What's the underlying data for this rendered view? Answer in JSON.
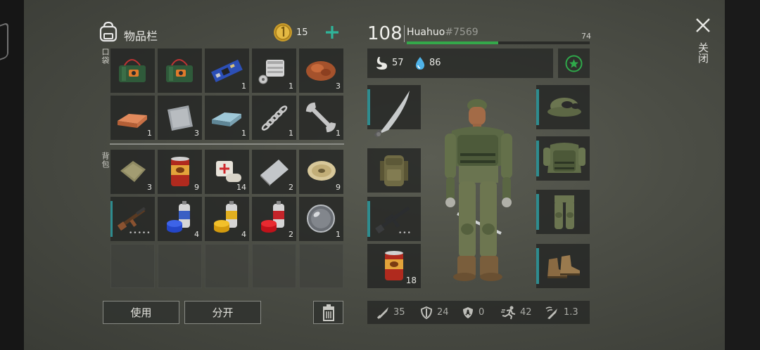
{
  "inventory": {
    "title": "物品栏",
    "coins": "15",
    "pocket_label": "口袋",
    "backpack_label": "背包",
    "pocket_items": [
      {
        "icon": "explosive-pack-icon",
        "count": ""
      },
      {
        "icon": "explosive-pack-icon",
        "count": ""
      },
      {
        "icon": "circuit-board-icon",
        "count": "1"
      },
      {
        "icon": "engine-part-icon",
        "count": "1"
      },
      {
        "icon": "meat-icon",
        "count": "3"
      },
      {
        "icon": "copper-ingot-icon",
        "count": "1"
      },
      {
        "icon": "metal-plate-icon",
        "count": "3"
      },
      {
        "icon": "steel-ingot-icon",
        "count": "1"
      },
      {
        "icon": "spring-icon",
        "count": "1"
      },
      {
        "icon": "wrench-icon",
        "count": "1"
      }
    ],
    "backpack_items": [
      {
        "icon": "cloth-icon",
        "count": "3"
      },
      {
        "icon": "canned-food-icon",
        "count": "9"
      },
      {
        "icon": "bandage-icon",
        "count": "14"
      },
      {
        "icon": "steel-sheet-icon",
        "count": "2"
      },
      {
        "icon": "wire-spool-icon",
        "count": "9"
      },
      {
        "icon": "assault-rifle-icon",
        "count": ""
      },
      {
        "icon": "blue-spray-paint-icon",
        "count": "4"
      },
      {
        "icon": "yellow-spray-paint-icon",
        "count": "4"
      },
      {
        "icon": "red-spray-paint-icon",
        "count": "2"
      },
      {
        "icon": "glass-lens-icon",
        "count": "1"
      }
    ],
    "use_button": "使用",
    "split_button": "分开"
  },
  "character": {
    "level": "108",
    "name": "Huahuo",
    "tag": "#7569",
    "xp_value": "74",
    "xp_progress": 0.5,
    "hunger": "57",
    "thirst": "86",
    "close_label": "关闭",
    "equipment": {
      "weapon_left_top": {
        "icon": "machete-icon"
      },
      "backpack": {
        "icon": "backpack-icon"
      },
      "rifle": {
        "icon": "m16-rifle-icon"
      },
      "food": {
        "icon": "canned-food-icon",
        "count": "18"
      },
      "head": {
        "icon": "camo-cap-icon"
      },
      "body": {
        "icon": "camo-vest-icon"
      },
      "legs": {
        "icon": "camo-pants-icon"
      },
      "feet": {
        "icon": "boots-icon"
      }
    },
    "stats": {
      "attack": "35",
      "defense": "24",
      "radiation": "0",
      "speed": "42",
      "rate": "1.3"
    }
  },
  "colors": {
    "accent": "#2e8c8f",
    "xp_bar": "#34a84a",
    "plus": "#2fb59a"
  }
}
